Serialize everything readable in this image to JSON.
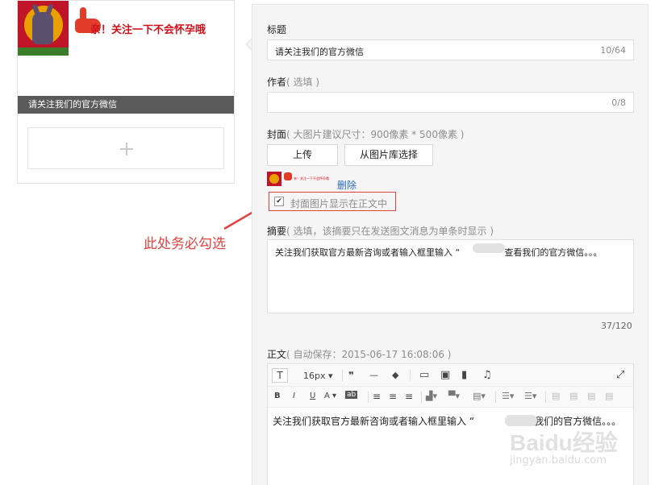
{
  "preview": {
    "banner_text": "亲！关注一下不会怀孕哦",
    "title": "请关注我们的官方微信",
    "add_symbol": "+"
  },
  "annotation": {
    "text": "此处务必勾选",
    "color": "#e24242"
  },
  "form": {
    "title_label": "标题",
    "title_value": "请关注我们的官方微信",
    "title_count": "10/64",
    "author_label": "作者",
    "author_hint": "( 选填 )",
    "author_value": "",
    "author_count": "0/8",
    "cover_label": "封面",
    "cover_hint": "( 大图片建议尺寸：900像素 * 500像素 )",
    "upload_button": "上传",
    "library_button": "从图片库选择",
    "cover_thumb_text": "亲！关注一下不会怀孕哦",
    "delete_link": "删除",
    "show_cover_checkbox": {
      "checked": true,
      "label": "封面图片显示在正文中"
    },
    "summary_label": "摘要",
    "summary_hint": "( 选填，该摘要只在发送图文消息为单条时显示 )",
    "summary_value_before": "关注我们获取官方最新咨询或者输入框里输入 “",
    "summary_value_after": "” 查看我们的官方微信。。。",
    "summary_count": "37/120",
    "body_label": "正文",
    "body_hint": "( 自动保存：2015-06-17 16:08:06 )"
  },
  "editor": {
    "toolbar1": {
      "text_style": "T",
      "font_size": "16px",
      "quote": "❞",
      "hr": "—",
      "eraser": "◆",
      "video": "▭",
      "image": "▣",
      "chart": "▮",
      "music": "♫",
      "fullscreen": "⤢"
    },
    "toolbar2": {
      "bold": "B",
      "italic": "I",
      "underline": "U",
      "font_color": "A",
      "bg_color": "ab",
      "align_left": "≡",
      "align_center": "≡",
      "align_right": "≡"
    },
    "content_before": "关注我们获取官方最新咨询或者输入框里输入 “",
    "content_after": "” 查看我们的官方微信。。。"
  },
  "watermark": {
    "main": "Baidu经验",
    "sub": "jingyan.baidu.com"
  },
  "colors": {
    "accent_red": "#e24242",
    "link_blue": "#2b6ac0",
    "panel_bg": "#f5f5f5"
  }
}
